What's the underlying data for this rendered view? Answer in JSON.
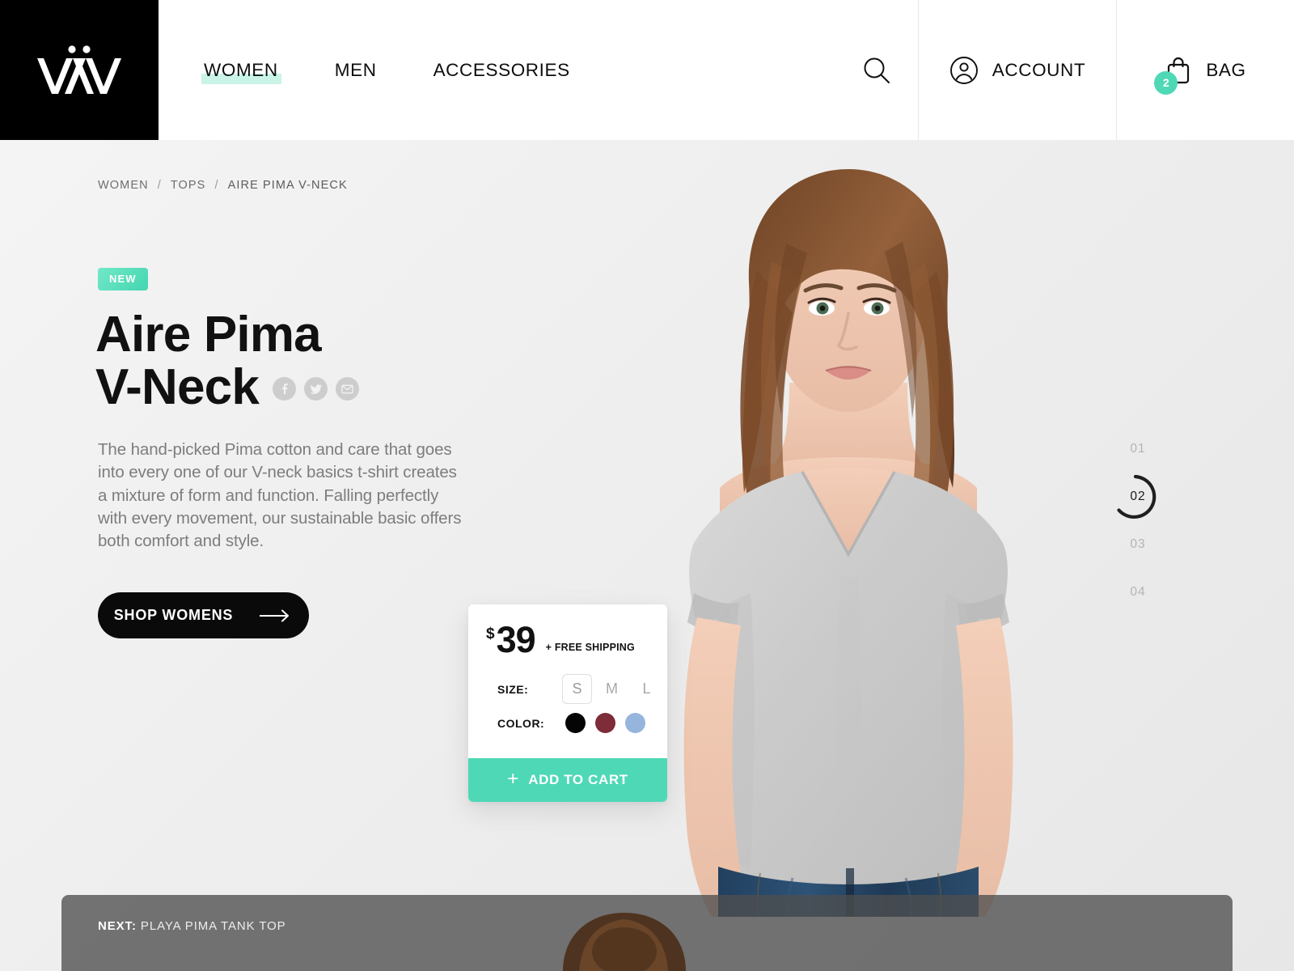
{
  "header": {
    "logo_text": "VÄV",
    "logo_icon": "vav-logo",
    "nav": [
      {
        "label": "WOMEN",
        "active": true
      },
      {
        "label": "MEN",
        "active": false
      },
      {
        "label": "ACCESSORIES",
        "active": false
      }
    ],
    "search_icon": "search-icon",
    "account_icon": "account-icon",
    "account_label": "ACCOUNT",
    "bag_icon": "shopping-bag-icon",
    "bag_label": "BAG",
    "bag_count": "2"
  },
  "breadcrumb": {
    "items": [
      "WOMEN",
      "TOPS",
      "AIRE PIMA V-NECK"
    ],
    "separator": "/"
  },
  "product": {
    "badge": "NEW",
    "title_line1": "Aire Pima",
    "title_line2": "V-Neck",
    "description": "The hand-picked Pima cotton and care that goes into every one of our V-neck basics t-shirt creates a mixture of form and function. Falling perfectly with every movement, our sustainable basic offers both comfort and style.",
    "social": [
      {
        "name": "facebook-icon",
        "label": "f"
      },
      {
        "name": "twitter-icon",
        "label": "t"
      },
      {
        "name": "email-icon",
        "label": "e"
      }
    ],
    "cta_label": "SHOP WOMENS",
    "cta_icon": "arrow-right-icon"
  },
  "buy_card": {
    "currency": "$",
    "price": "39",
    "shipping_note": "+ FREE SHIPPING",
    "size_label": "SIZE:",
    "sizes": [
      {
        "label": "S",
        "selected": true
      },
      {
        "label": "M",
        "selected": false
      },
      {
        "label": "L",
        "selected": false
      }
    ],
    "color_label": "COLOR:",
    "colors": [
      {
        "name": "black",
        "hex": "#050505",
        "selected": true
      },
      {
        "name": "burgundy",
        "hex": "#7d2c38",
        "selected": false
      },
      {
        "name": "light-blue",
        "hex": "#96b5dd",
        "selected": false
      }
    ],
    "add_to_cart_label": "ADD TO CART",
    "add_to_cart_icon": "plus-icon"
  },
  "carousel": {
    "slides": [
      "01",
      "02",
      "03",
      "04"
    ],
    "active_index": 1
  },
  "next_product": {
    "prefix": "NEXT:",
    "title": "PLAYA PIMA TANK TOP"
  },
  "colors": {
    "accent_teal": "#4ed8b6",
    "nav_highlight": "#c9f4e7",
    "dark": "#0a0a0a",
    "text_muted": "#7d7d7d",
    "page_bg": "#efefef"
  }
}
